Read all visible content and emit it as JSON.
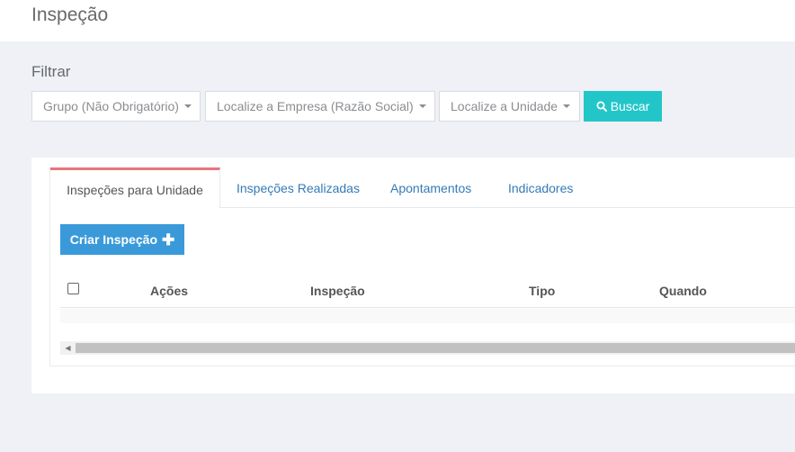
{
  "header": {
    "title": "Inspeção"
  },
  "filter": {
    "label": "Filtrar",
    "group_dropdown": "Grupo (Não Obrigatório)",
    "company_dropdown": "Localize a Empresa (Razão Social)",
    "unit_dropdown": "Localize a Unidade",
    "search_button": "Buscar",
    "search_icon": "search-icon",
    "accent_color": "#23c6c8"
  },
  "tabs": [
    {
      "label": "Inspeções para Unidade",
      "active": true
    },
    {
      "label": "Inspeções Realizadas",
      "active": false
    },
    {
      "label": "Apontamentos",
      "active": false
    },
    {
      "label": "Indicadores",
      "active": false
    }
  ],
  "active_tab_color": "#e9747c",
  "main": {
    "create_button": "Criar Inspeção",
    "create_icon": "plus-icon",
    "create_color": "#3a9ad9"
  },
  "table": {
    "columns": [
      "Ações",
      "Inspeção",
      "Tipo",
      "Quando"
    ],
    "rows": []
  }
}
